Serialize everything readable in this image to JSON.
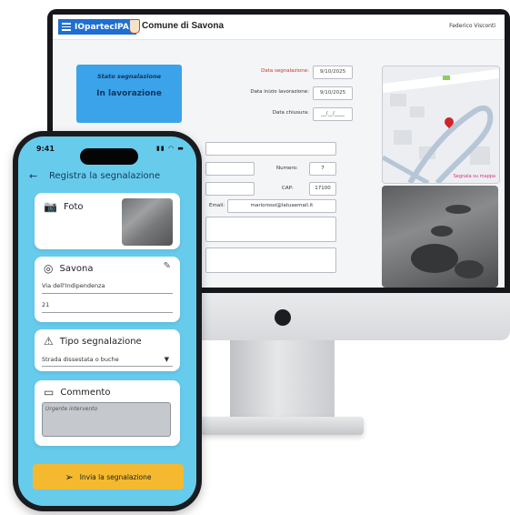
{
  "desktop": {
    "brand": "IOpartecIPA",
    "comune_title": "Comune di Savona",
    "user_name": "Federico Visconti",
    "state_title": "Stato segnalazione",
    "state_value": "In lavorazione",
    "dates": [
      {
        "label": "Data segnalazione:",
        "value": "9/10/2025"
      },
      {
        "label": "Data inizio lavorazione:",
        "value": "9/10/2025"
      },
      {
        "label": "Data chiusura:",
        "value": "__/__/____"
      }
    ],
    "numero_label": "Numero:",
    "numero_value": "7",
    "cap_label": "CAP:",
    "cap_value": "17100",
    "email_label": "Email:",
    "email_value": "mariorossi@latuaemail.it",
    "map_link": "Segnala su mappa"
  },
  "phone": {
    "time": "9:41",
    "status_icons": "▮▮ ◠ ▬",
    "header_title": "Registra la segnalazione",
    "back_glyph": "←",
    "photo_label": "Foto",
    "location_label": "Savona",
    "street_value": "Via dell'Indipendenza",
    "number_value": "21",
    "type_label": "Tipo segnalazione",
    "type_value": "Strada dissestata o buche",
    "comment_label": "Commento",
    "comment_value": "Urgente intervento",
    "send_label": "Invia la segnalazione"
  },
  "colors": {
    "phone_bg": "#67cbec",
    "brand_blue": "#1e6fd1",
    "state_blue": "#3aa3ea",
    "send_yellow": "#f4b92f",
    "date_label_red": "#c0392b"
  }
}
